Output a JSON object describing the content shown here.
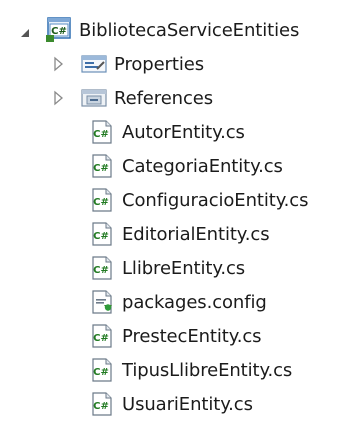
{
  "tree": {
    "root": {
      "label": "BibliotecaServiceEntities",
      "icon": "csharp-project-icon",
      "expanded": true
    },
    "children": [
      {
        "label": "Properties",
        "icon": "properties-folder-icon",
        "expandable": true
      },
      {
        "label": "References",
        "icon": "references-folder-icon",
        "expandable": true
      },
      {
        "label": "AutorEntity.cs",
        "icon": "csharp-file-icon"
      },
      {
        "label": "CategoriaEntity.cs",
        "icon": "csharp-file-icon"
      },
      {
        "label": "ConfiguracioEntity.cs",
        "icon": "csharp-file-icon"
      },
      {
        "label": "EditorialEntity.cs",
        "icon": "csharp-file-icon"
      },
      {
        "label": "LlibreEntity.cs",
        "icon": "csharp-file-icon"
      },
      {
        "label": "packages.config",
        "icon": "config-file-icon"
      },
      {
        "label": "PrestecEntity.cs",
        "icon": "csharp-file-icon"
      },
      {
        "label": "TipusLlibreEntity.cs",
        "icon": "csharp-file-icon"
      },
      {
        "label": "UsuariEntity.cs",
        "icon": "csharp-file-icon"
      }
    ]
  }
}
